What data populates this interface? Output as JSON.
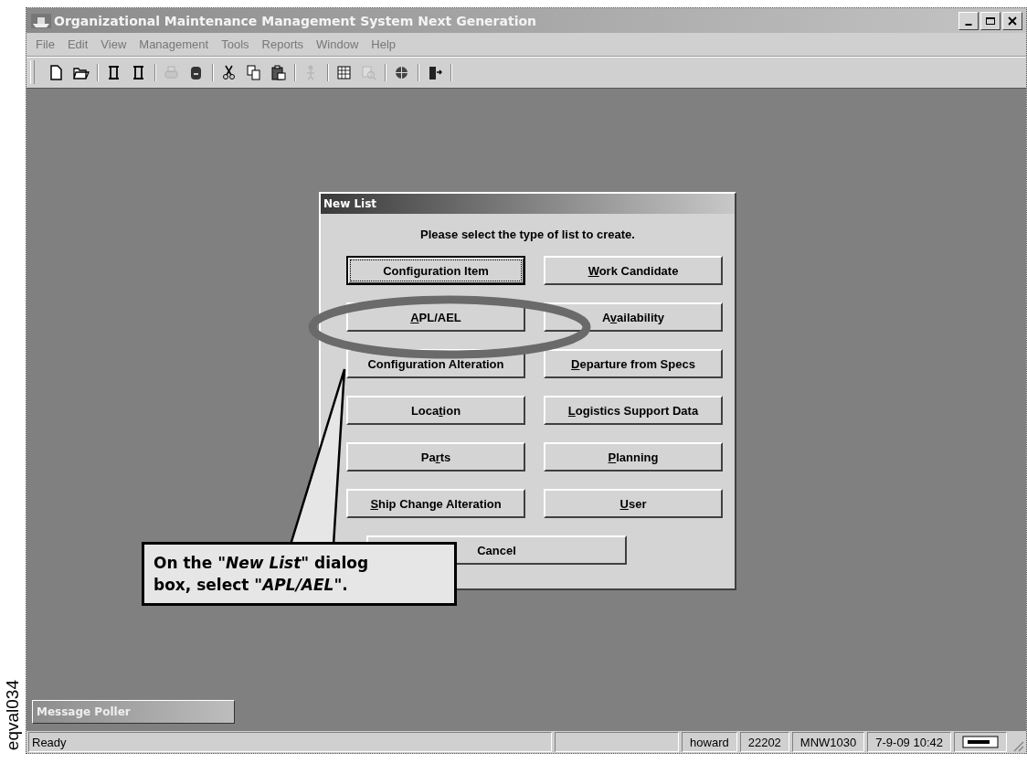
{
  "figure_label": "eqval034",
  "window": {
    "title": "Organizational Maintenance Management System Next Generation"
  },
  "menu": [
    "File",
    "Edit",
    "View",
    "Management",
    "Tools",
    "Reports",
    "Window",
    "Help"
  ],
  "toolbar": [
    [
      {
        "kind": "new",
        "disabled": false
      },
      {
        "kind": "open",
        "disabled": false
      }
    ],
    [
      {
        "kind": "scroll",
        "disabled": false
      },
      {
        "kind": "scroll",
        "disabled": false
      }
    ],
    [
      {
        "kind": "print",
        "disabled": true
      },
      {
        "kind": "database",
        "disabled": false
      }
    ],
    [
      {
        "kind": "cut",
        "disabled": false
      },
      {
        "kind": "copy",
        "disabled": false
      },
      {
        "kind": "paste",
        "disabled": false
      }
    ],
    [
      {
        "kind": "figure",
        "disabled": true
      }
    ],
    [
      {
        "kind": "grid",
        "disabled": false
      },
      {
        "kind": "search",
        "disabled": true
      }
    ],
    [
      {
        "kind": "globe",
        "disabled": false
      }
    ],
    [
      {
        "kind": "exit",
        "disabled": false
      }
    ]
  ],
  "minimized_windows": [
    {
      "title": "Message Poller"
    }
  ],
  "dialog": {
    "title": "New List",
    "prompt": "Please select the type of list to create.",
    "buttons": [
      {
        "pre": "Configuration Item",
        "focused": true
      },
      {
        "key": "W",
        "post": "ork Candidate",
        "focused": false
      },
      {
        "key": "A",
        "post": "PL/AEL",
        "focused": false
      },
      {
        "pre": "A",
        "key": "v",
        "post": "ailability",
        "focused": false
      },
      {
        "pre": "Configuration Alteration",
        "focused": false
      },
      {
        "key": "D",
        "post": "eparture from Specs",
        "focused": false
      },
      {
        "pre": "Loca",
        "key": "t",
        "post": "ion",
        "focused": false
      },
      {
        "key": "L",
        "post": "ogistics Support Data",
        "focused": false
      },
      {
        "pre": "Pa",
        "key": "r",
        "post": "ts",
        "focused": false
      },
      {
        "key": "P",
        "post": "lanning",
        "focused": false
      },
      {
        "key": "S",
        "post": "hip Change Alteration",
        "focused": false
      },
      {
        "key": "U",
        "post": "ser",
        "focused": false
      }
    ],
    "cancel": "Cancel"
  },
  "callout": {
    "text": "On the *\"New List\"* dialog box, select *\"APL/AEL\"*."
  },
  "status_bar": [
    {
      "kind": "text",
      "text": "Ready"
    },
    {
      "kind": "blank"
    },
    {
      "kind": "text",
      "text": "howard"
    },
    {
      "kind": "text",
      "text": "22202"
    },
    {
      "kind": "text",
      "text": "MNW1030"
    },
    {
      "kind": "text",
      "text": "7-9-09 10:42"
    },
    {
      "kind": "keyboard"
    }
  ]
}
